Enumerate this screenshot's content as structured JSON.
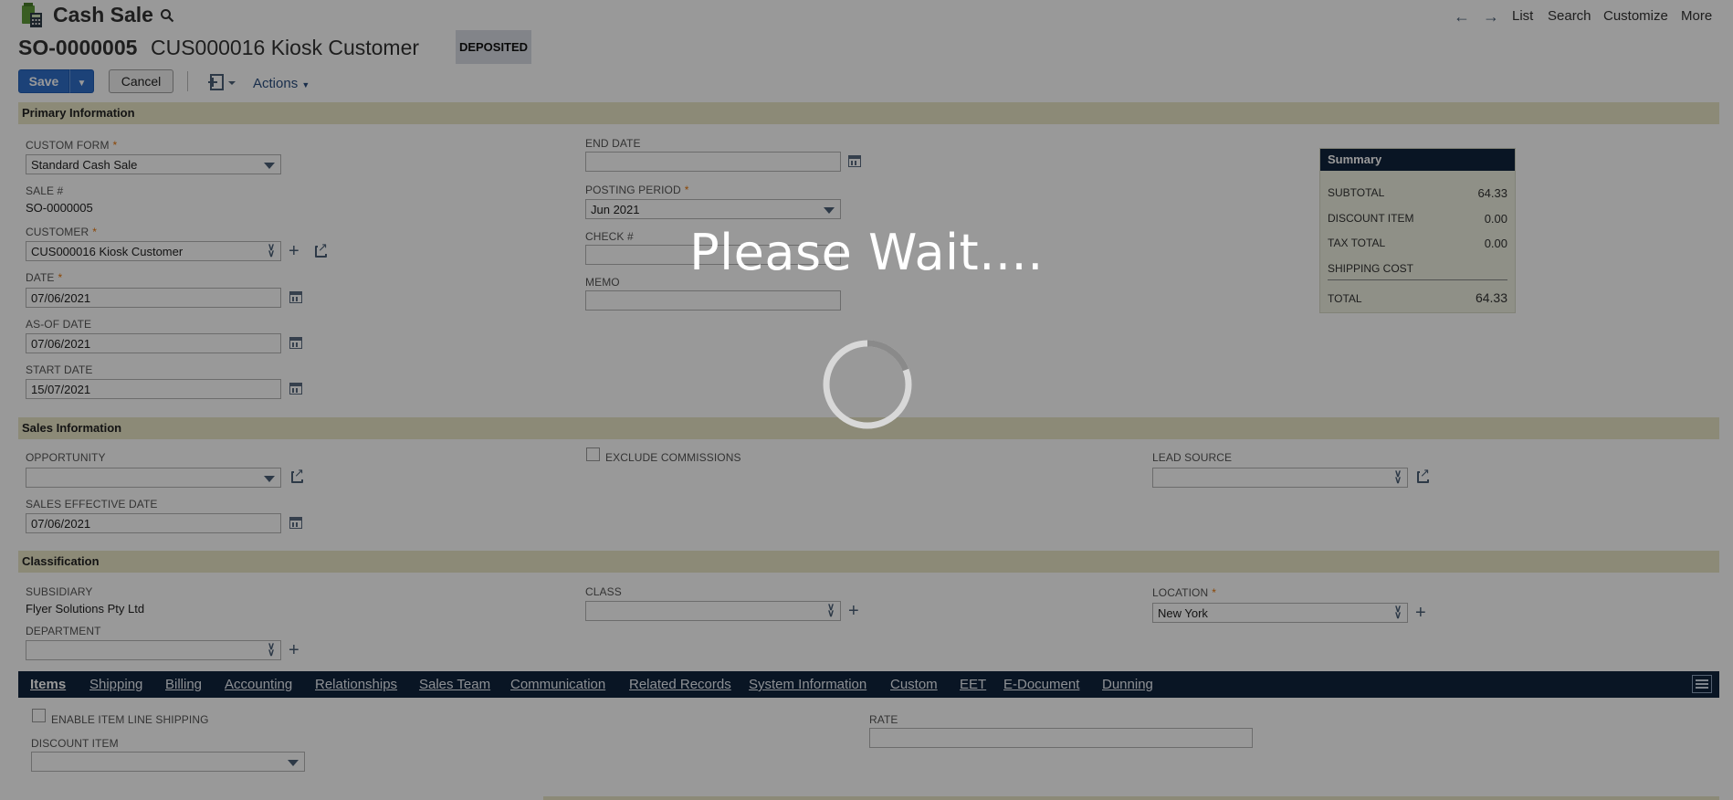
{
  "header": {
    "record_type": "Cash Sale",
    "record_number": "SO-0000005",
    "customer_name": "CUS000016 Kiosk Customer",
    "status_badge": "DEPOSITED",
    "nav_links": [
      "List",
      "Search",
      "Customize",
      "More"
    ]
  },
  "toolbar": {
    "save_label": "Save",
    "cancel_label": "Cancel",
    "actions_label": "Actions"
  },
  "primary": {
    "section_title": "Primary Information",
    "custom_form_label": "CUSTOM FORM",
    "custom_form_value": "Standard Cash Sale",
    "sale_no_label": "SALE #",
    "sale_no_value": "SO-0000005",
    "customer_label": "CUSTOMER",
    "customer_value": "CUS000016 Kiosk Customer",
    "date_label": "DATE",
    "date_value": "07/06/2021",
    "as_of_date_label": "AS-OF DATE",
    "as_of_date_value": "07/06/2021",
    "start_date_label": "START DATE",
    "start_date_value": "15/07/2021",
    "end_date_label": "END DATE",
    "end_date_value": "",
    "posting_period_label": "POSTING PERIOD",
    "posting_period_value": "Jun 2021",
    "check_label": "CHECK #",
    "memo_label": "MEMO"
  },
  "summary": {
    "title": "Summary",
    "subtotal_label": "SUBTOTAL",
    "subtotal_value": "64.33",
    "discount_label": "DISCOUNT ITEM",
    "discount_value": "0.00",
    "tax_label": "TAX TOTAL",
    "tax_value": "0.00",
    "shipping_label": "SHIPPING COST",
    "total_label": "TOTAL",
    "total_value": "64.33"
  },
  "sales": {
    "section_title": "Sales Information",
    "opportunity_label": "OPPORTUNITY",
    "exclude_commissions_label": "EXCLUDE COMMISSIONS",
    "lead_source_label": "LEAD SOURCE",
    "sales_effective_date_label": "SALES EFFECTIVE DATE",
    "sales_effective_date_value": "07/06/2021"
  },
  "classification": {
    "section_title": "Classification",
    "subsidiary_label": "SUBSIDIARY",
    "subsidiary_value": "Flyer Solutions Pty Ltd",
    "class_label": "CLASS",
    "location_label": "LOCATION",
    "location_value": "New York",
    "department_label": "DEPARTMENT"
  },
  "tabs": [
    {
      "label": "Items",
      "active": true
    },
    {
      "label": "Shipping"
    },
    {
      "label": "Billing"
    },
    {
      "label": "Accounting"
    },
    {
      "label": "Relationships"
    },
    {
      "label": "Sales Team"
    },
    {
      "label": "Communication"
    },
    {
      "label": "Related Records"
    },
    {
      "label": "System Information"
    },
    {
      "label": "Custom"
    },
    {
      "label": "EET"
    },
    {
      "label": "E-Document"
    },
    {
      "label": "Dunning"
    }
  ],
  "items_tab": {
    "enable_line_shipping_label": "ENABLE ITEM LINE SHIPPING",
    "discount_item_label": "DISCOUNT ITEM",
    "rate_label": "RATE"
  },
  "loading": {
    "message": "Please Wait...."
  },
  "colors": {
    "accent_blue": "#2f6ec9",
    "tab_bar": "#10233d",
    "section_bar": "#e9e6c6",
    "required": "#e8760a"
  }
}
